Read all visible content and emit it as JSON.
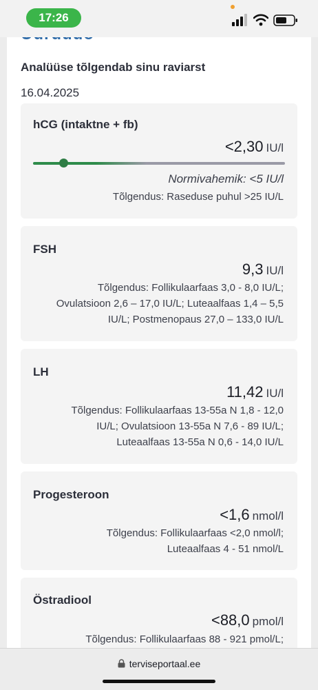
{
  "status_bar": {
    "time": "17:26",
    "accent_color": "#3bb54a"
  },
  "header": {
    "cut_heading": "Uuruuuo",
    "notice": "Analüüse tõlgendab sinu raviarst",
    "date": "16.04.2025"
  },
  "results": [
    {
      "name": "hCG (intaktne + fb)",
      "value": "<2,30",
      "unit": "IU/l",
      "normal_range": "Normivahemik: <5 IU/l",
      "interpretation": [
        "Tõlgendus: Raseduse puhul >25 IU/L"
      ],
      "indicator_level": 0.12
    },
    {
      "name": "FSH",
      "value": "9,3",
      "unit": "IU/l",
      "interpretation": [
        "Tõlgendus: Follikulaarfaas 3,0 - 8,0 IU/L;",
        "Ovulatsioon 2,6 – 17,0 IU/L; Luteaalfaas 1,4 – 5,5",
        "IU/L; Postmenopaus 27,0 – 133,0 IU/L"
      ]
    },
    {
      "name": "LH",
      "value": "11,42",
      "unit": "IU/l",
      "interpretation": [
        "Tõlgendus: Follikulaarfaas 13-55a N 1,8 -  12,0",
        "IU/L; Ovulatsioon 13-55a N 7,6 -  89 IU/L;",
        "Luteaalfaas 13-55a N 0,6 - 14,0 IU/L"
      ]
    },
    {
      "name": "Progesteroon",
      "value": "<1,6",
      "unit": "nmol/l",
      "interpretation": [
        "Tõlgendus: Follikulaarfaas <2,0 nmol/l;",
        "Luteaalfaas 4 - 51 nmol/L"
      ]
    },
    {
      "name": "Östradiool",
      "value": "<88,0",
      "unit": "pmol/l",
      "interpretation": [
        "Tõlgendus: Follikulaarfaas 88 - 921 pmol/L;"
      ]
    }
  ],
  "browser": {
    "url": "terviseportaal.ee"
  }
}
